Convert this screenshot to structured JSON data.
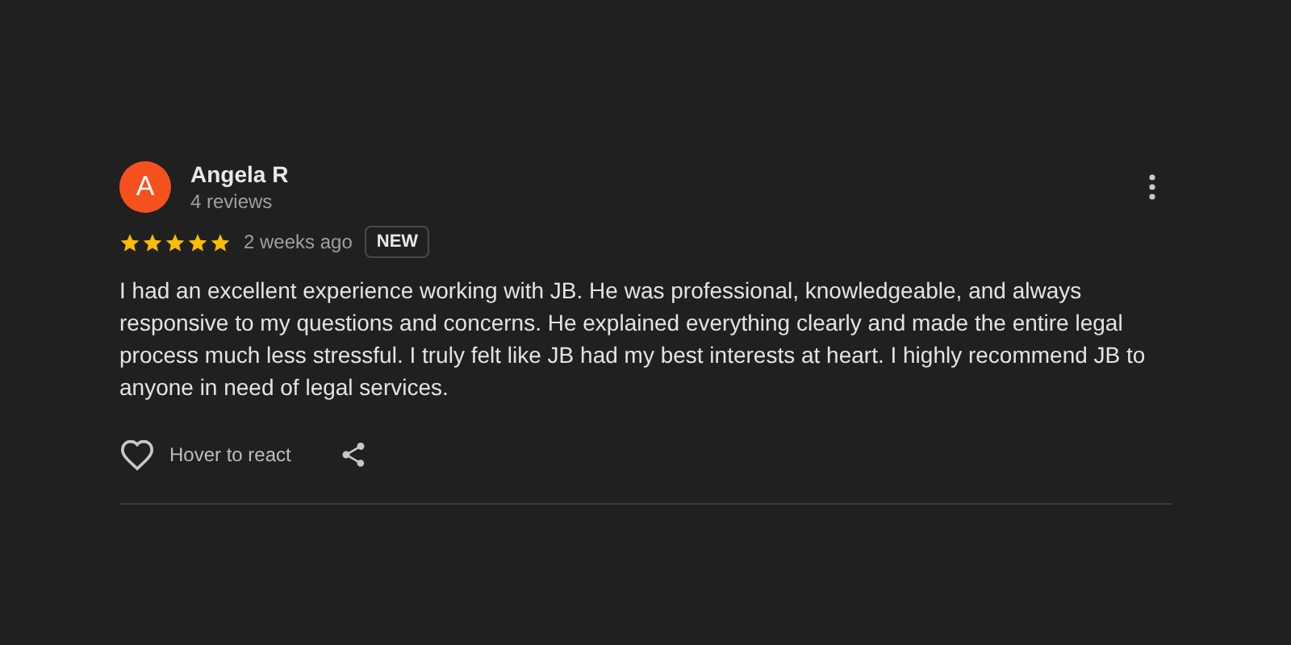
{
  "review": {
    "avatar_letter": "A",
    "author": "Angela R",
    "review_count": "4 reviews",
    "stars": 5,
    "time": "2 weeks ago",
    "badge": "NEW",
    "text": "I had an excellent experience working with JB. He was professional, knowledgeable, and always responsive to my questions and concerns. He explained everything clearly and made the entire legal process much less stressful. I truly felt like JB had my best interests at heart. I highly recommend JB to anyone in need of legal services.",
    "react_label": "Hover to react"
  }
}
